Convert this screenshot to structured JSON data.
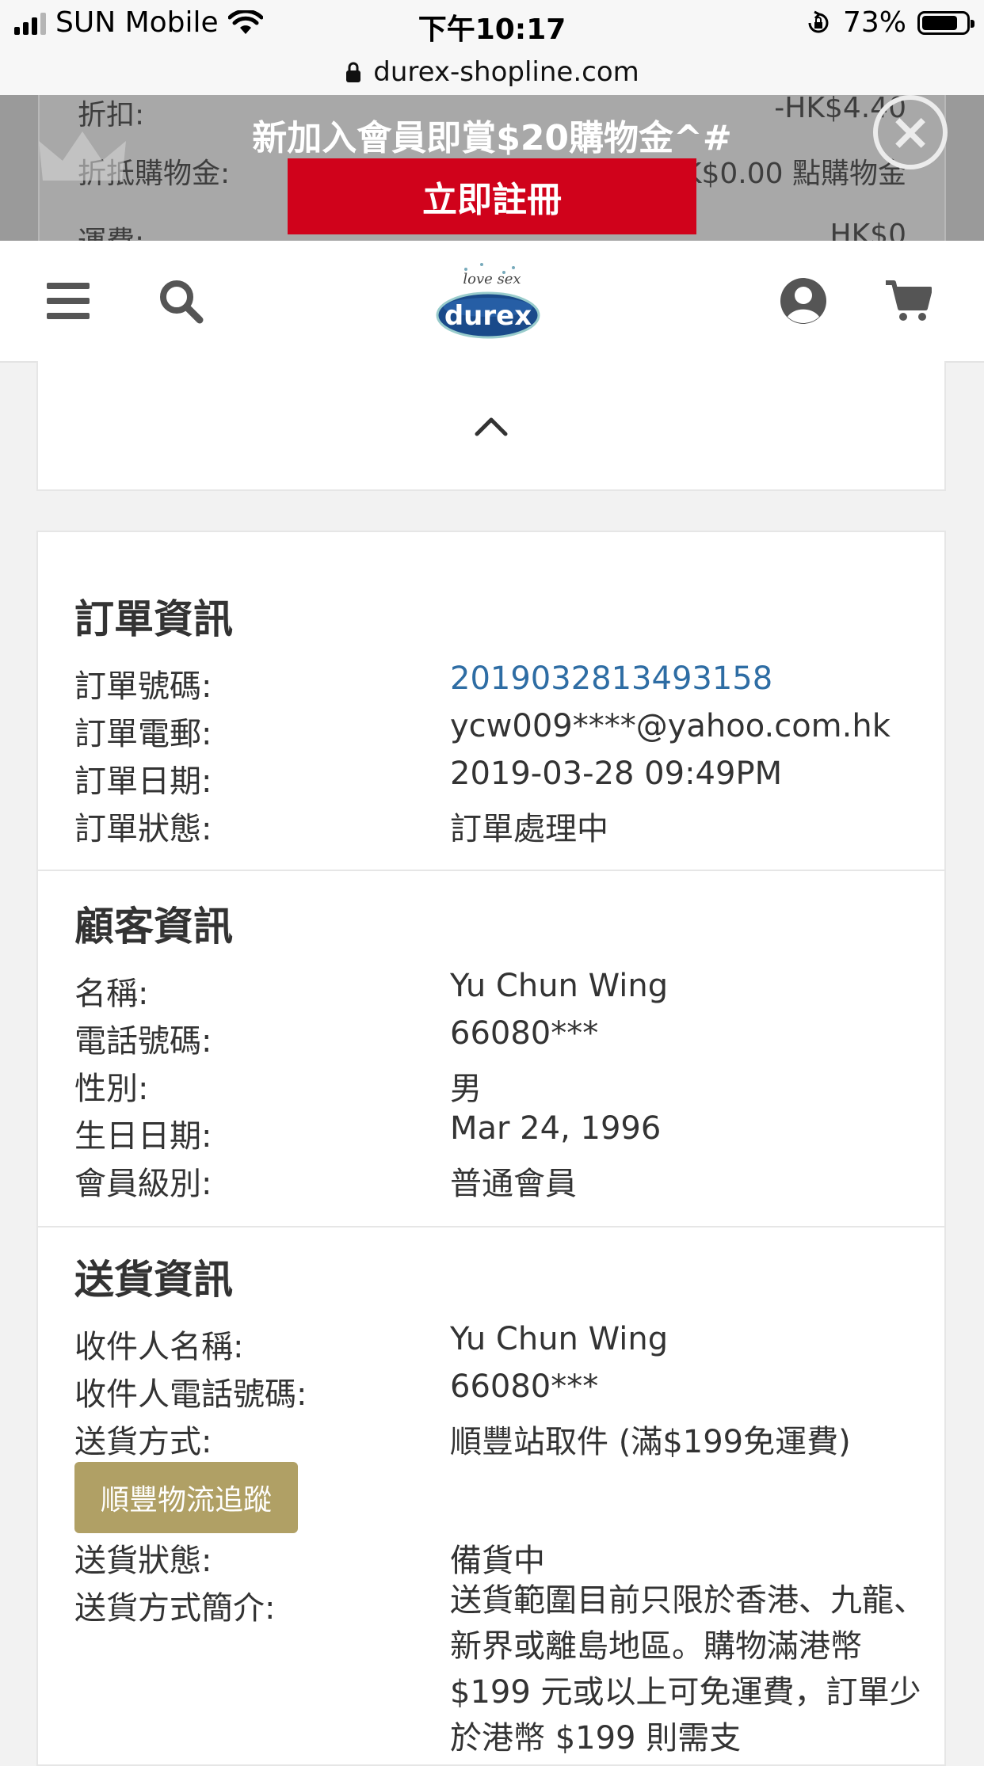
{
  "status_bar": {
    "carrier": "SUN Mobile",
    "time": "下午10:17",
    "battery": "73%",
    "battery_level": 0.73
  },
  "browser": {
    "url": "durex-shopline.com"
  },
  "promo_banner": {
    "title": "新加入會員即賞$20購物金^#",
    "button_label": "立即註冊",
    "close_icon": "×",
    "behind_rows": [
      {
        "label": "折扣:",
        "value": "-HK$4.40"
      },
      {
        "label": "折抵購物金:",
        "value": "HK$0.00 點購物金"
      },
      {
        "label": "運費:",
        "value": "HK$0"
      }
    ]
  },
  "header": {
    "logo_tagline": "love sex",
    "logo_text": "durex",
    "icons": [
      "menu-icon",
      "search-icon",
      "account-icon",
      "cart-icon"
    ]
  },
  "collapse_icon": "chevron-up-icon",
  "order_info": {
    "title": "訂單資訊",
    "rows": [
      {
        "label": "訂單號碼:",
        "value": "2019032813493158"
      },
      {
        "label": "訂單電郵:",
        "value": "ycw009****@yahoo.com.hk"
      },
      {
        "label": "訂單日期:",
        "value": "2019-03-28 09:49PM"
      },
      {
        "label": "訂單狀態:",
        "value": "訂單處理中"
      }
    ]
  },
  "customer_info": {
    "title": "顧客資訊",
    "rows": [
      {
        "label": "名稱:",
        "value": "Yu Chun Wing"
      },
      {
        "label": "電話號碼:",
        "value": "66080***"
      },
      {
        "label": "性別:",
        "value": "男"
      },
      {
        "label": "生日日期:",
        "value": "Mar 24, 1996"
      },
      {
        "label": "會員級別:",
        "value": "普通會員"
      }
    ]
  },
  "delivery_info": {
    "title": "送貨資訊",
    "rows": [
      {
        "label": "收件人名稱:",
        "value": "Yu Chun Wing"
      },
      {
        "label": "收件人電話號碼:",
        "value": "66080***"
      },
      {
        "label": "送貨方式:",
        "value": "順豐站取件 (滿$199免運費)"
      }
    ],
    "tracking_button": "順豐物流追蹤",
    "status_label": "送貨狀態:",
    "status_value": "備貨中",
    "description_label": "送貨方式簡介:",
    "description_value": "送貨範圍目前只限於香港、九龍、新界或離島地區。購物滿港幣 $199 元或以上可免運費，訂單少於港幣 $199 則需支"
  },
  "colors": {
    "accent_red": "#d0021b",
    "link_blue": "#2e6da4",
    "gold_button": "#b0a065"
  }
}
